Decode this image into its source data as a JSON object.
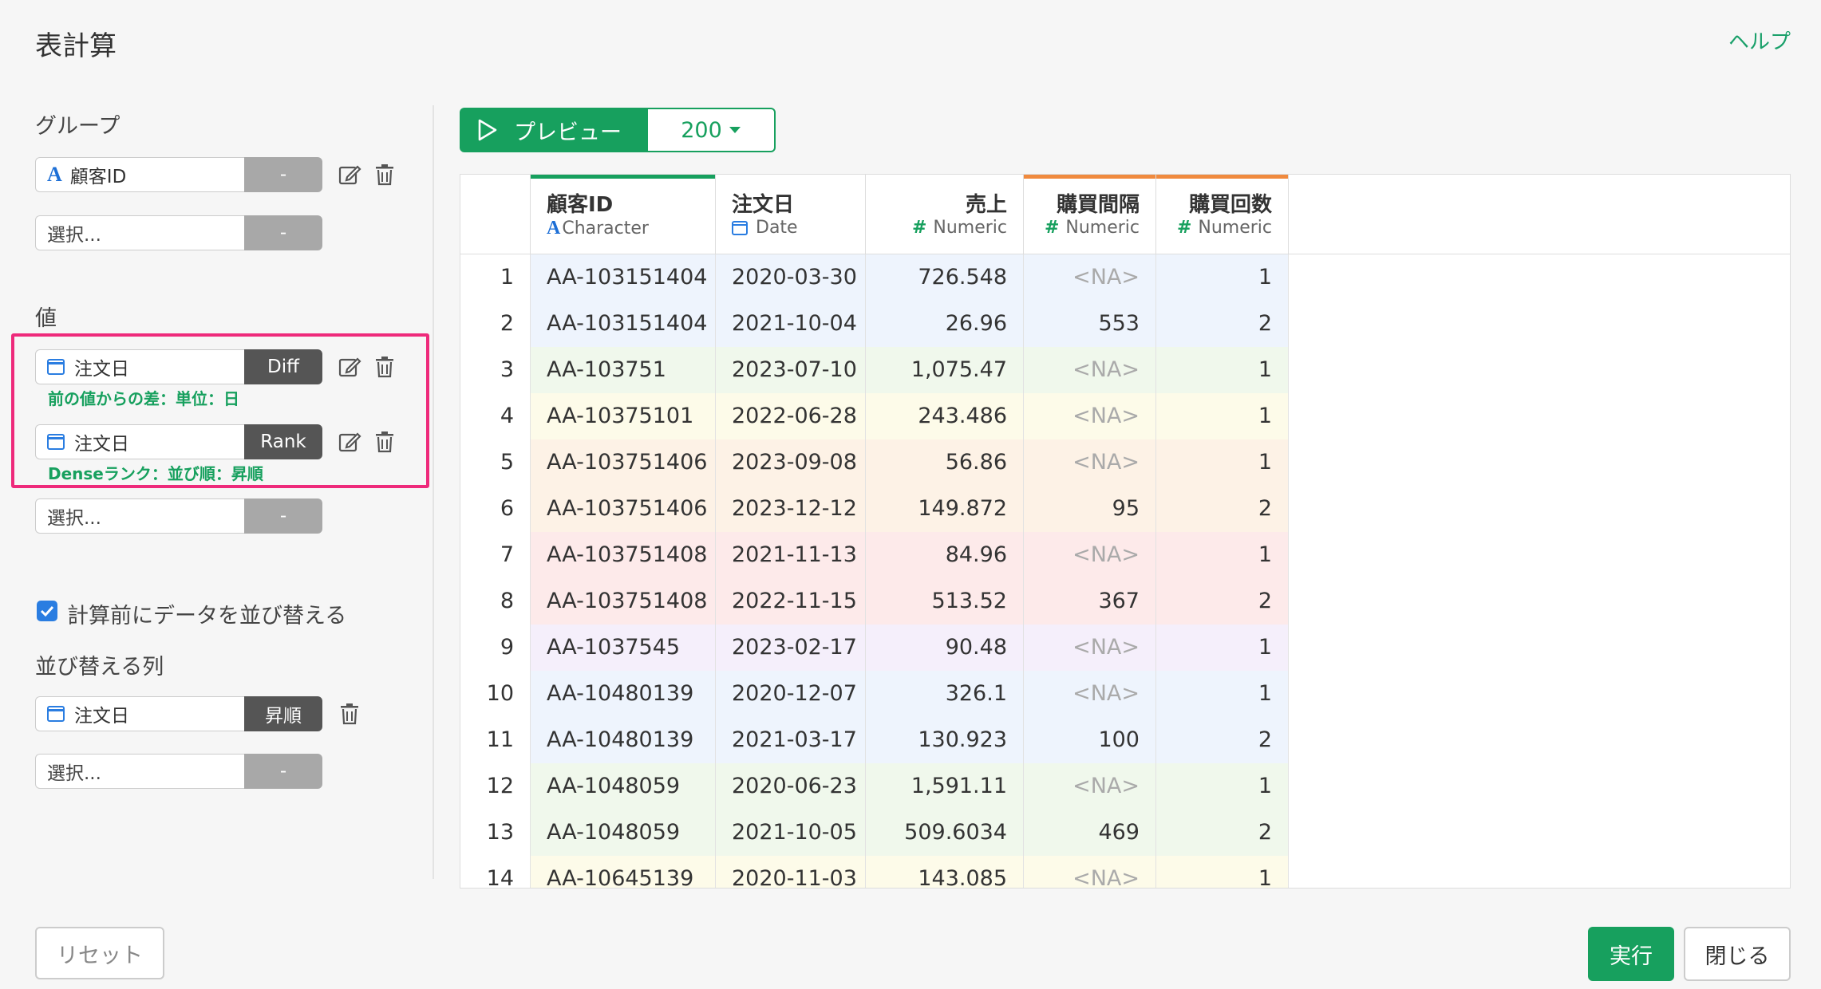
{
  "header": {
    "title": "表計算",
    "help": "ヘルプ"
  },
  "group": {
    "label": "グループ",
    "field1": {
      "name": "顧客ID",
      "btn": "-"
    },
    "field2": {
      "placeholder": "選択...",
      "btn": "-"
    }
  },
  "values": {
    "label": "値",
    "item1": {
      "name": "注文日",
      "btn": "Diff",
      "note": "前の値からの差：単位：日"
    },
    "item2": {
      "name": "注文日",
      "btn": "Rank",
      "note": "Denseランク：並び順：昇順"
    },
    "field3": {
      "placeholder": "選択...",
      "btn": "-"
    }
  },
  "sort": {
    "checkbox_label": "計算前にデータを並び替える",
    "label": "並び替える列",
    "item1": {
      "name": "注文日",
      "btn": "昇順"
    },
    "field2": {
      "placeholder": "選択...",
      "btn": "-"
    }
  },
  "preview": {
    "label": "プレビュー",
    "count": "200"
  },
  "table": {
    "columns": [
      {
        "name": "顧客ID",
        "type": "Character",
        "type_icon": "A",
        "bar": "#17a05e"
      },
      {
        "name": "注文日",
        "type": "Date",
        "type_icon": "calendar-icon",
        "bar": ""
      },
      {
        "name": "売上",
        "type": "Numeric",
        "type_icon": "#",
        "bar": ""
      },
      {
        "name": "購買間隔",
        "type": "Numeric",
        "type_icon": "#",
        "bar": "#f08a3e"
      },
      {
        "name": "購買回数",
        "type": "Numeric",
        "type_icon": "#",
        "bar": "#f08a3e"
      }
    ],
    "rows": [
      {
        "n": "1",
        "id": "AA-103151404",
        "date": "2020-03-30",
        "sales": "726.548",
        "gap": "<NA>",
        "count": "1",
        "color": "#eef4fd"
      },
      {
        "n": "2",
        "id": "AA-103151404",
        "date": "2021-10-04",
        "sales": "26.96",
        "gap": "553",
        "count": "2",
        "color": "#eef4fd"
      },
      {
        "n": "3",
        "id": "AA-103751",
        "date": "2023-07-10",
        "sales": "1,075.47",
        "gap": "<NA>",
        "count": "1",
        "color": "#f0f8ec"
      },
      {
        "n": "4",
        "id": "AA-10375101",
        "date": "2022-06-28",
        "sales": "243.486",
        "gap": "<NA>",
        "count": "1",
        "color": "#fdfbe9"
      },
      {
        "n": "5",
        "id": "AA-103751406",
        "date": "2023-09-08",
        "sales": "56.86",
        "gap": "<NA>",
        "count": "1",
        "color": "#fdf2e6"
      },
      {
        "n": "6",
        "id": "AA-103751406",
        "date": "2023-12-12",
        "sales": "149.872",
        "gap": "95",
        "count": "2",
        "color": "#fdf2e6"
      },
      {
        "n": "7",
        "id": "AA-103751408",
        "date": "2021-11-13",
        "sales": "84.96",
        "gap": "<NA>",
        "count": "1",
        "color": "#fdeaea"
      },
      {
        "n": "8",
        "id": "AA-103751408",
        "date": "2022-11-15",
        "sales": "513.52",
        "gap": "367",
        "count": "2",
        "color": "#fdeaea"
      },
      {
        "n": "9",
        "id": "AA-1037545",
        "date": "2023-02-17",
        "sales": "90.48",
        "gap": "<NA>",
        "count": "1",
        "color": "#f5effb"
      },
      {
        "n": "10",
        "id": "AA-10480139",
        "date": "2020-12-07",
        "sales": "326.1",
        "gap": "<NA>",
        "count": "1",
        "color": "#eef4fd"
      },
      {
        "n": "11",
        "id": "AA-10480139",
        "date": "2021-03-17",
        "sales": "130.923",
        "gap": "100",
        "count": "2",
        "color": "#eef4fd"
      },
      {
        "n": "12",
        "id": "AA-1048059",
        "date": "2020-06-23",
        "sales": "1,591.11",
        "gap": "<NA>",
        "count": "1",
        "color": "#f0f8ec"
      },
      {
        "n": "13",
        "id": "AA-1048059",
        "date": "2021-10-05",
        "sales": "509.6034",
        "gap": "469",
        "count": "2",
        "color": "#f0f8ec"
      },
      {
        "n": "14",
        "id": "AA-10645139",
        "date": "2020-11-03",
        "sales": "143.085",
        "gap": "<NA>",
        "count": "1",
        "color": "#fdfbe9"
      }
    ]
  },
  "footer": {
    "reset": "リセット",
    "run": "実行",
    "close": "閉じる"
  }
}
